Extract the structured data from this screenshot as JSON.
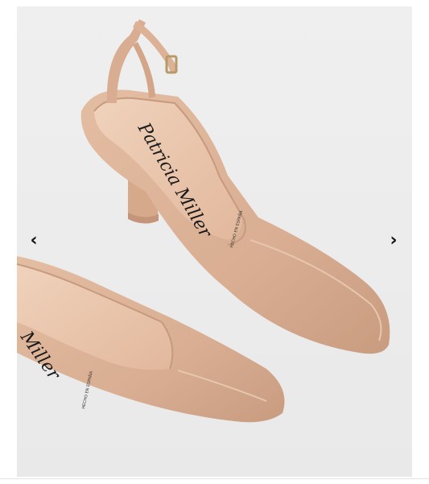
{
  "gallery": {
    "prev_icon": "chevron-left-icon",
    "next_icon": "chevron-right-icon",
    "prev_glyph": "‹",
    "next_glyph": "›"
  },
  "product_photo": {
    "brand_insole_text": "Patricia Miller",
    "brand_insole_text_left": "Miller",
    "insole_stamp": "HECHO EN ESPAÑA",
    "colors": {
      "background": "#eeeeee",
      "leather": "#ddb59a",
      "leather_shadow": "#c49578",
      "insole": "#e8c4aa",
      "lettering": "#1a1a1a"
    }
  }
}
